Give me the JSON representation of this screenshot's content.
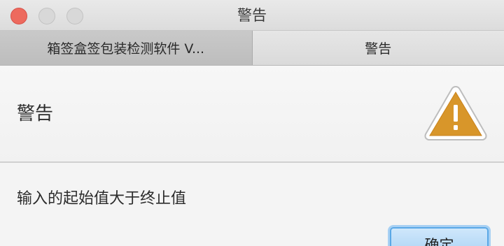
{
  "window": {
    "title": "警告"
  },
  "tabs": [
    {
      "label": "箱签盒签包装检测软件 V...",
      "active": false
    },
    {
      "label": "警告",
      "active": true
    }
  ],
  "dialog": {
    "header": "警告",
    "icon": "warning-triangle-icon",
    "message": "输入的起始值大于终止值",
    "ok_label": "确定"
  },
  "colors": {
    "close": "#ed6a5e",
    "warning": "#d89a2c",
    "button_focus": "#5aa8e6"
  }
}
